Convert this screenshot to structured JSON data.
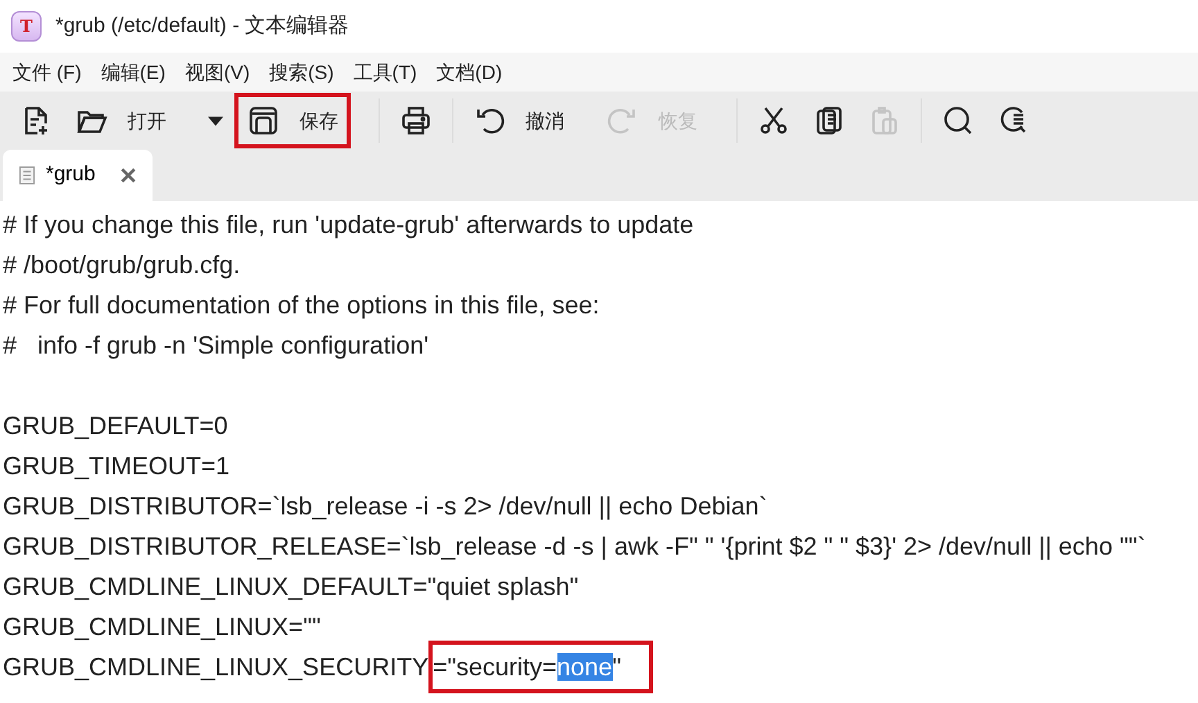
{
  "window": {
    "title": "*grub (/etc/default) - 文本编辑器",
    "app_icon": {
      "letter": "T"
    }
  },
  "menu": [
    "文件 (F)",
    "编辑(E)",
    "视图(V)",
    "搜索(S)",
    "工具(T)",
    "文档(D)"
  ],
  "toolbar": [
    {
      "kind": "button",
      "disabled": false,
      "highlighted": false
    },
    {
      "kind": "button",
      "label": "打开",
      "disabled": false,
      "highlighted": false
    },
    {
      "kind": "dropdown",
      "disabled": false,
      "highlighted": false
    },
    {
      "kind": "button",
      "label": "保存",
      "disabled": false,
      "highlighted": true
    },
    {
      "kind": "separator"
    },
    {
      "kind": "button",
      "disabled": false,
      "highlighted": false
    },
    {
      "kind": "separator"
    },
    {
      "kind": "button",
      "label": "撤消",
      "disabled": false,
      "highlighted": false
    },
    {
      "kind": "button",
      "label": "恢复",
      "disabled": true,
      "highlighted": false
    },
    {
      "kind": "separator"
    },
    {
      "kind": "button",
      "disabled": false,
      "highlighted": false
    },
    {
      "kind": "button",
      "disabled": false,
      "highlighted": false
    },
    {
      "kind": "button",
      "disabled": true,
      "highlighted": false
    },
    {
      "kind": "separator"
    },
    {
      "kind": "button",
      "disabled": false,
      "highlighted": false
    },
    {
      "kind": "button",
      "disabled": false,
      "highlighted": false
    }
  ],
  "tabs": [
    {
      "label": "*grub",
      "selected": true
    }
  ],
  "editor": {
    "lines": [
      {
        "kind": "text",
        "text": "# If you change this file, run 'update-grub' afterwards to update"
      },
      {
        "kind": "text",
        "text": "# /boot/grub/grub.cfg."
      },
      {
        "kind": "text",
        "text": "# For full documentation of the options in this file, see:"
      },
      {
        "kind": "text",
        "text": "#   info -f grub -n 'Simple configuration'"
      },
      {
        "kind": "blank"
      },
      {
        "kind": "text",
        "text": "GRUB_DEFAULT=0"
      },
      {
        "kind": "text",
        "text": "GRUB_TIMEOUT=1"
      },
      {
        "kind": "text",
        "text": "GRUB_DISTRIBUTOR=`lsb_release -i -s 2> /dev/null || echo Debian`"
      },
      {
        "kind": "text",
        "text": "GRUB_DISTRIBUTOR_RELEASE=`lsb_release -d -s | awk -F\" \" '{print $2 \" \" $3}' 2> /dev/null || echo \"\"`"
      },
      {
        "kind": "text",
        "text": "GRUB_CMDLINE_LINUX_DEFAULT=\"quiet splash\""
      },
      {
        "kind": "text",
        "text": "GRUB_CMDLINE_LINUX=\"\""
      },
      {
        "kind": "segments",
        "segments": [
          {
            "kind": "plain",
            "text": "GRUB_CMDLINE_LINUX_SECURITY",
            "selected": false
          },
          {
            "kind": "box",
            "segments": [
              {
                "text": "=\"security=",
                "selected": false
              },
              {
                "text": "none",
                "selected": true
              },
              {
                "text": "\"",
                "selected": false
              }
            ]
          }
        ]
      }
    ]
  }
}
